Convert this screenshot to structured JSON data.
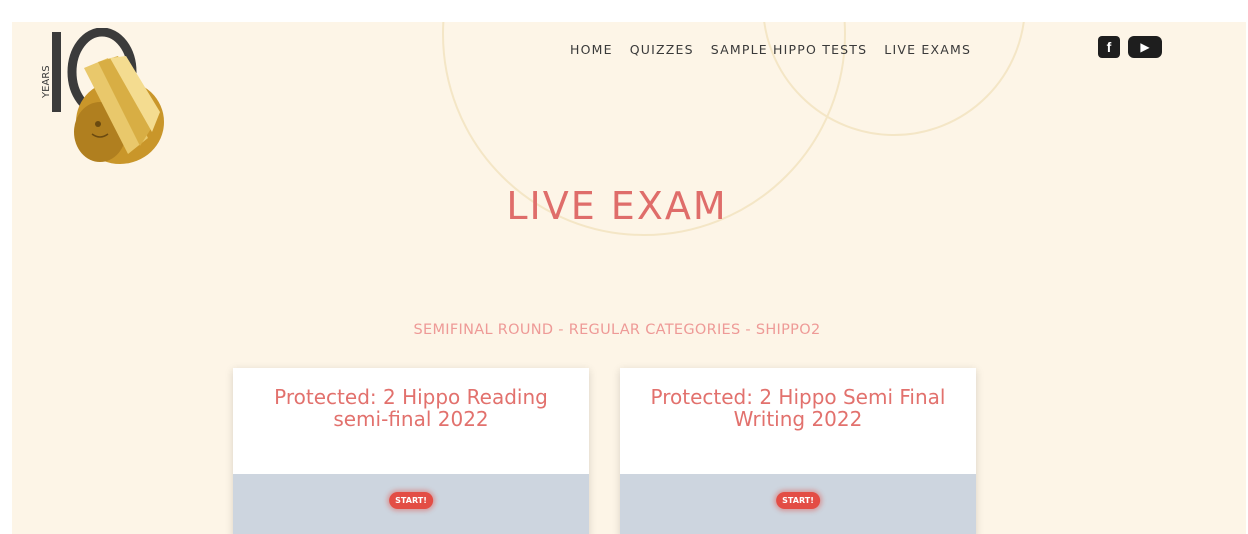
{
  "header": {
    "logo": {
      "text": "YEARS",
      "number": "10"
    },
    "nav": [
      "HOME",
      "QUIZZES",
      "SAMPLE HIPPO TESTS",
      "LIVE EXAMS"
    ],
    "social": {
      "facebook_icon": "f",
      "youtube_icon": "▶"
    }
  },
  "main": {
    "title": "LIVE EXAM",
    "round_label": "SEMIFINAL ROUND - REGULAR CATEGORIES - SHIPPO2",
    "cards": [
      {
        "title": "Protected: 2 Hippo Reading semi-final 2022",
        "button": "START!"
      },
      {
        "title": "Protected: 2 Hippo Semi Final Writing 2022",
        "button": "START!"
      }
    ]
  }
}
